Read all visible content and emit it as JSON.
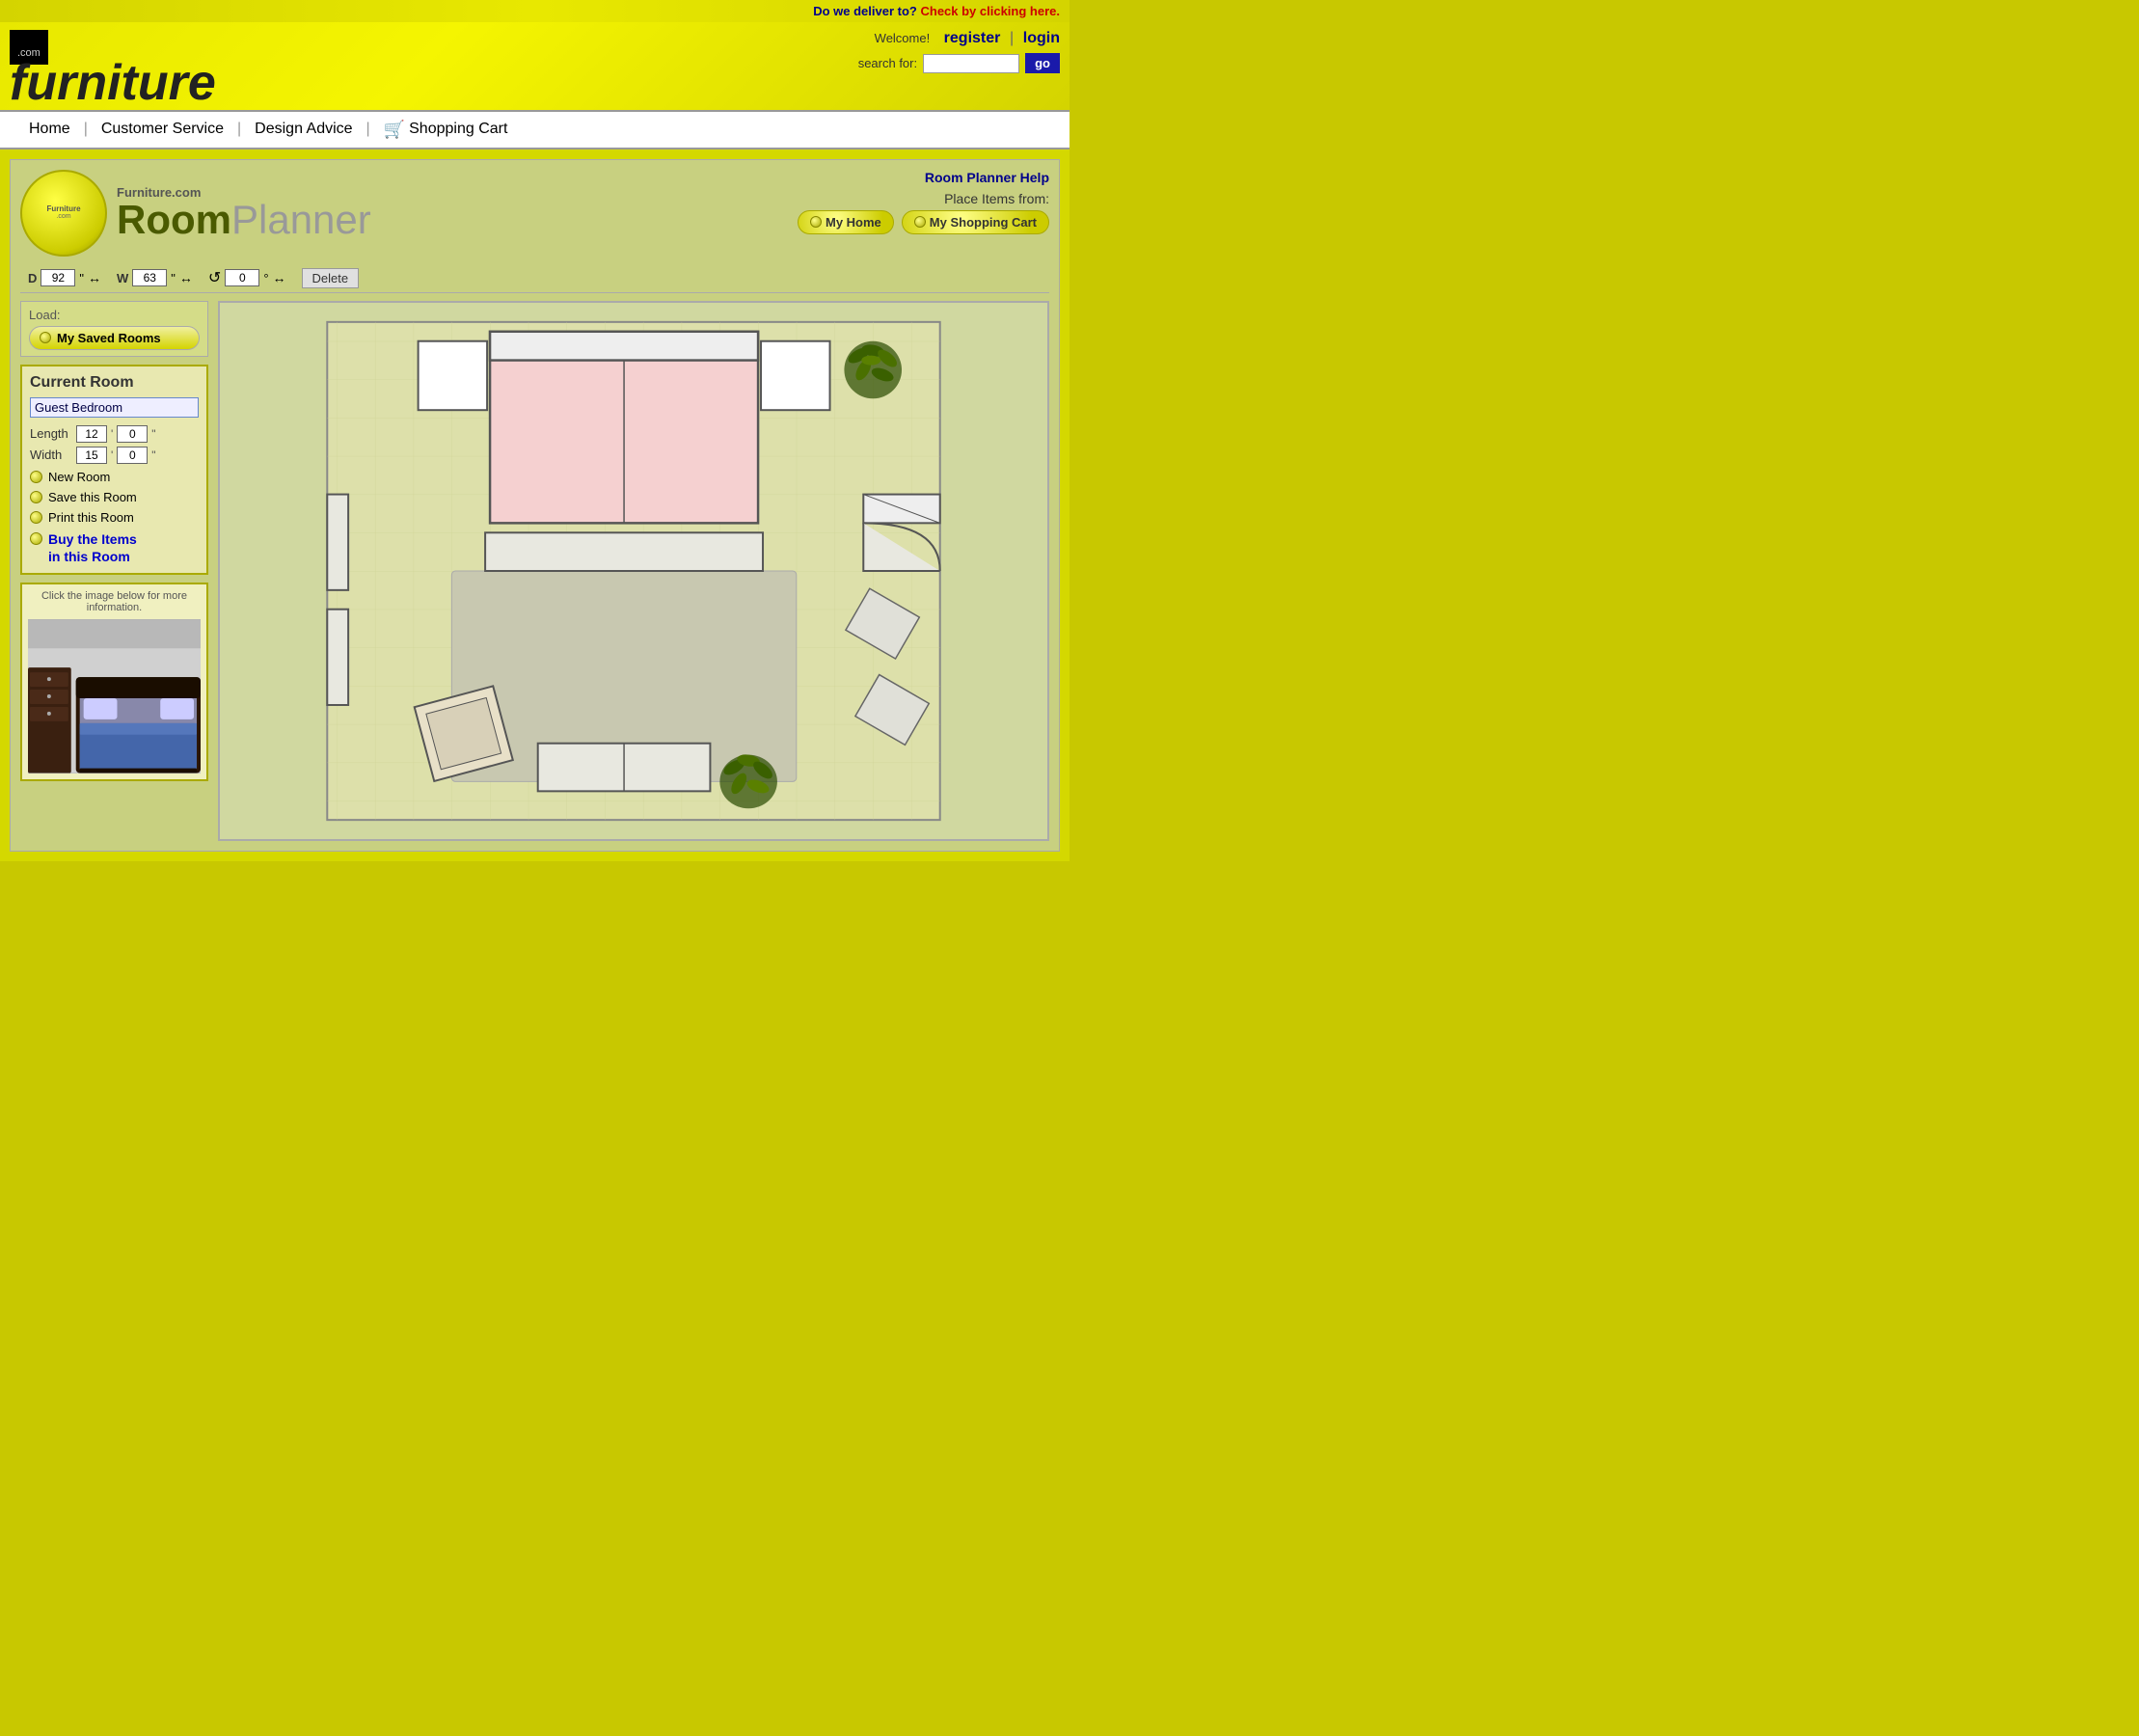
{
  "delivery_bar": {
    "question": "Do we deliver to?",
    "check_link": "Check by clicking here."
  },
  "header": {
    "logo_com": ".com",
    "logo_main": "furniture",
    "welcome": "Welcome!",
    "register": "register",
    "separator": "|",
    "login": "login",
    "search_label": "search for:",
    "search_placeholder": "",
    "go_button": "go"
  },
  "nav": {
    "items": [
      {
        "label": "Home",
        "id": "home"
      },
      {
        "label": "Customer Service",
        "id": "customer-service"
      },
      {
        "label": "Design Advice",
        "id": "design-advice"
      },
      {
        "label": "Shopping Cart",
        "id": "shopping-cart"
      }
    ]
  },
  "planner": {
    "dot_com": "Furniture.com",
    "title_room": "Room",
    "title_planner": "Planner",
    "help_link": "Room Planner Help",
    "place_items_label": "Place Items from:",
    "my_home_btn": "My Home",
    "my_cart_btn": "My Shopping Cart",
    "controls": {
      "d_label": "D",
      "d_value": "92",
      "d_unit": "\"",
      "w_label": "W",
      "w_value": "63",
      "w_unit": "\"",
      "r_value": "0",
      "r_unit": "°",
      "delete_btn": "Delete"
    },
    "load_section": {
      "label": "Load:",
      "btn_label": "My Saved Rooms"
    },
    "current_room": {
      "title": "Current Room",
      "room_name": "Guest Bedroom",
      "length_label": "Length",
      "length_ft": "12",
      "length_in": "0",
      "width_label": "Width",
      "width_ft": "15",
      "width_in": "0",
      "actions": [
        {
          "id": "new-room",
          "label": "New Room"
        },
        {
          "id": "save-room",
          "label": "Save this Room"
        },
        {
          "id": "print-room",
          "label": "Print this Room"
        },
        {
          "id": "buy-items",
          "label": "Buy the Items\nin this Room",
          "style": "buy"
        }
      ]
    },
    "info_box": {
      "title": "Click the image below for more information."
    }
  }
}
